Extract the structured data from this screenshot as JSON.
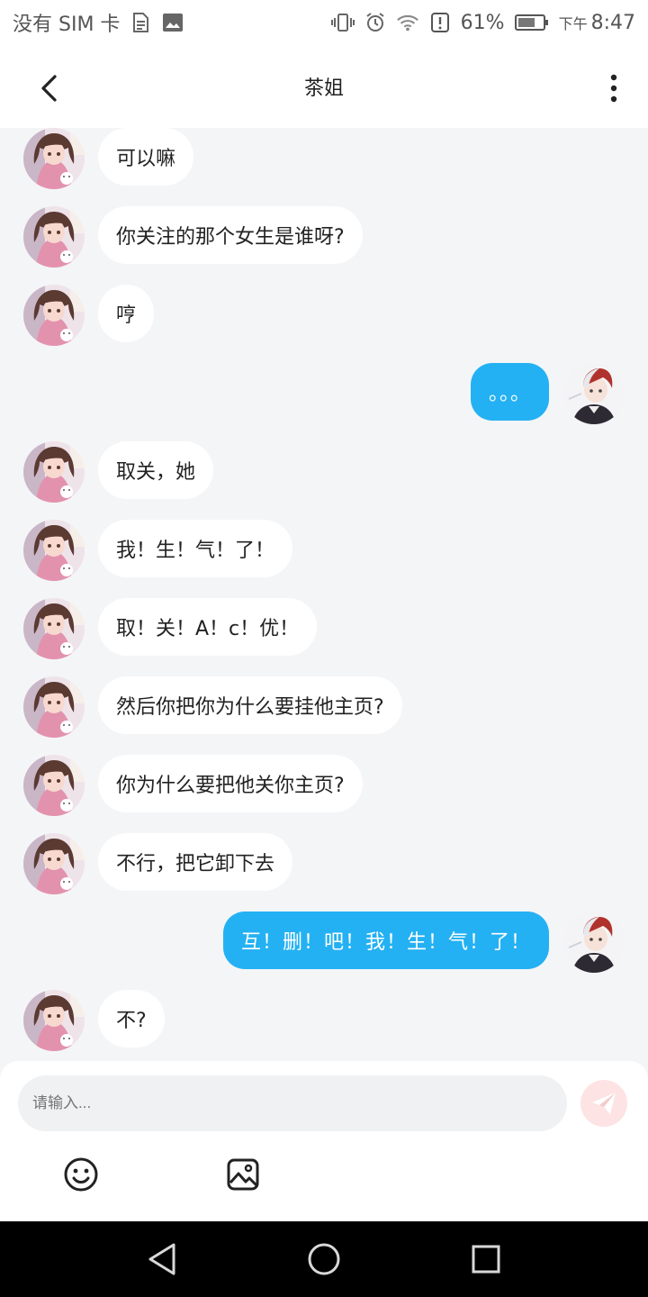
{
  "status_bar": {
    "carrier": "没有 SIM 卡",
    "battery": "61%",
    "time_prefix": "下午",
    "time": "8:47"
  },
  "header": {
    "title": "茶姐"
  },
  "messages": [
    {
      "side": "left",
      "text": "可以嘛"
    },
    {
      "side": "left",
      "text": "你关注的那个女生是谁呀?"
    },
    {
      "side": "left",
      "text": "哼"
    },
    {
      "side": "right",
      "text": "。。。"
    },
    {
      "side": "left",
      "text": "取关，她"
    },
    {
      "side": "left",
      "text": "我！生！气！了！"
    },
    {
      "side": "left",
      "text": "取！关！A！c！优！"
    },
    {
      "side": "left",
      "text": "然后你把你为什么要挂他主页?"
    },
    {
      "side": "left",
      "text": "你为什么要把他关你主页?"
    },
    {
      "side": "left",
      "text": "不行，把它卸下去"
    },
    {
      "side": "right",
      "text": "互！删！吧！我！生！气！了！"
    },
    {
      "side": "left",
      "text": "不?"
    }
  ],
  "composer": {
    "placeholder": "请输入..."
  },
  "colors": {
    "accent": "#24b1f3",
    "background": "#f4f5f7",
    "send_button": "#fde3e3"
  },
  "icons": [
    "back-icon",
    "more-icon",
    "send-icon",
    "emoji-icon",
    "image-icon",
    "nav-back-icon",
    "nav-home-icon",
    "nav-recents-icon"
  ]
}
